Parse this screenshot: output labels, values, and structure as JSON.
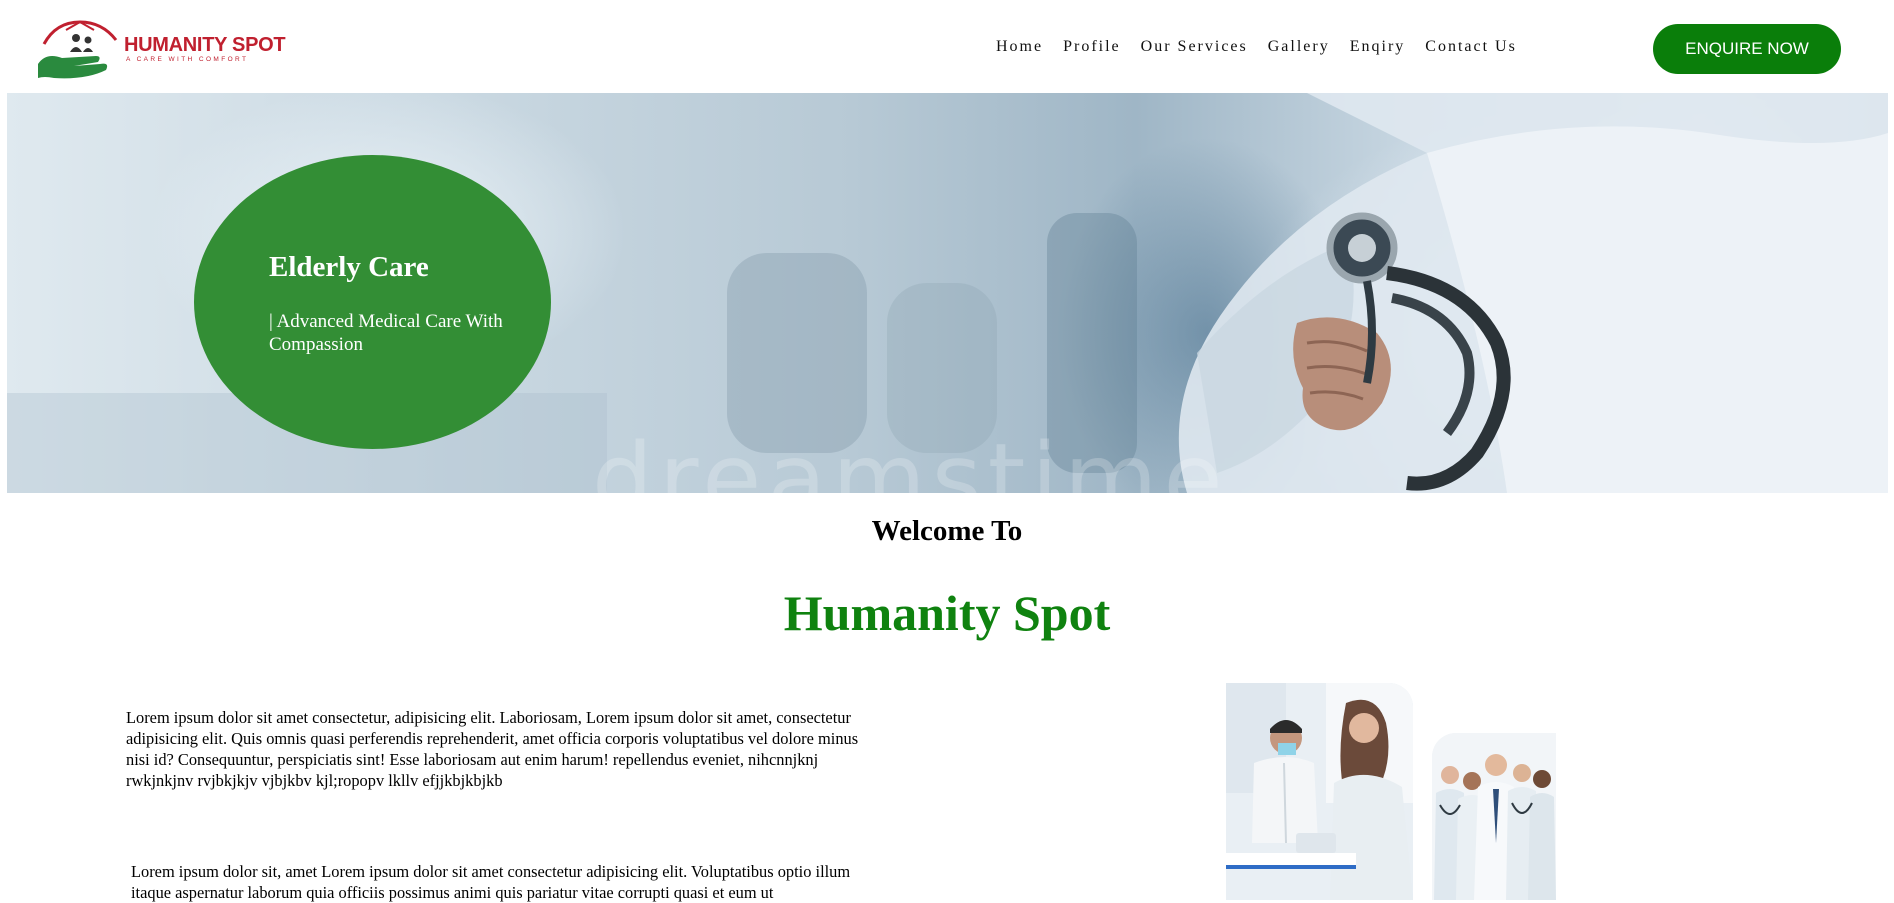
{
  "brand": {
    "name": "HUMANITY SPOT",
    "tagline": "A CARE WITH COMFORT"
  },
  "nav": {
    "items": [
      "Home",
      "Profile",
      "Our Services",
      "Gallery",
      "Enqiry",
      "Contact Us"
    ]
  },
  "header": {
    "cta_label": "ENQUIRE NOW"
  },
  "hero": {
    "title": "Elderly Care",
    "subtitle": "| Advanced Medical Care With Compassion",
    "watermark": "dreamstime"
  },
  "welcome": {
    "heading": "Welcome To",
    "brand": "Humanity Spot"
  },
  "content": {
    "paragraph1": "Lorem ipsum dolor sit amet consectetur, adipisicing elit. Laboriosam, Lorem ipsum dolor sit amet, consectetur adipisicing elit. Quis omnis quasi perferendis reprehenderit, amet officia corporis voluptatibus vel dolore minus nisi id? Consequuntur, perspiciatis sint! Esse laboriosam aut enim harum! repellendus eveniet, nihcnnjknj rwkjnkjnv rvjbkjkjv vjbjkbv kjl;ropopv lkllv efjjkbjkbjkb",
    "paragraph2": "Lorem ipsum dolor sit, amet Lorem ipsum dolor sit amet consectetur adipisicing elit. Voluptatibus optio illum itaque aspernatur laborum quia officiis possimus animi quis pariatur vitae corrupti quasi et eum ut"
  },
  "colors": {
    "brand_red": "#c0202f",
    "brand_green": "#0f820f",
    "cta_green": "#0a7e0a",
    "hero_circle": "#338e35"
  },
  "icons": {
    "logo": "house-family-hand-logo"
  }
}
